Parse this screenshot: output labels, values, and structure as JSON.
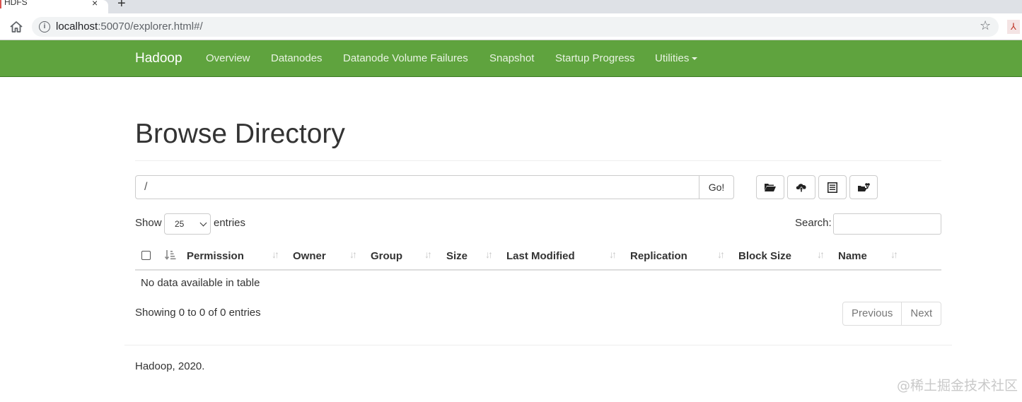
{
  "browser": {
    "tab_title": "HDFS",
    "tab_close": "×",
    "new_tab": "+",
    "url_host": "localhost",
    "url_rest": ":50070/explorer.html#/"
  },
  "navbar": {
    "brand": "Hadoop",
    "items": [
      {
        "label": "Overview"
      },
      {
        "label": "Datanodes"
      },
      {
        "label": "Datanode Volume Failures"
      },
      {
        "label": "Snapshot"
      },
      {
        "label": "Startup Progress"
      },
      {
        "label": "Utilities"
      }
    ],
    "color": "#5fa33e"
  },
  "page": {
    "title": "Browse Directory",
    "path_value": "/",
    "go_label": "Go!",
    "icon_buttons": [
      "open-folder-icon",
      "upload-cloud-icon",
      "list-icon",
      "cut-paste-icon"
    ]
  },
  "table": {
    "show_label": "Show",
    "page_length": "25",
    "entries_label": "entries",
    "search_label": "Search:",
    "columns": [
      "Permission",
      "Owner",
      "Group",
      "Size",
      "Last Modified",
      "Replication",
      "Block Size",
      "Name"
    ],
    "empty_message": "No data available in table",
    "info": "Showing 0 to 0 of 0 entries",
    "previous_label": "Previous",
    "next_label": "Next"
  },
  "footer": {
    "text": "Hadoop, 2020."
  },
  "watermark": "@稀土掘金技术社区"
}
